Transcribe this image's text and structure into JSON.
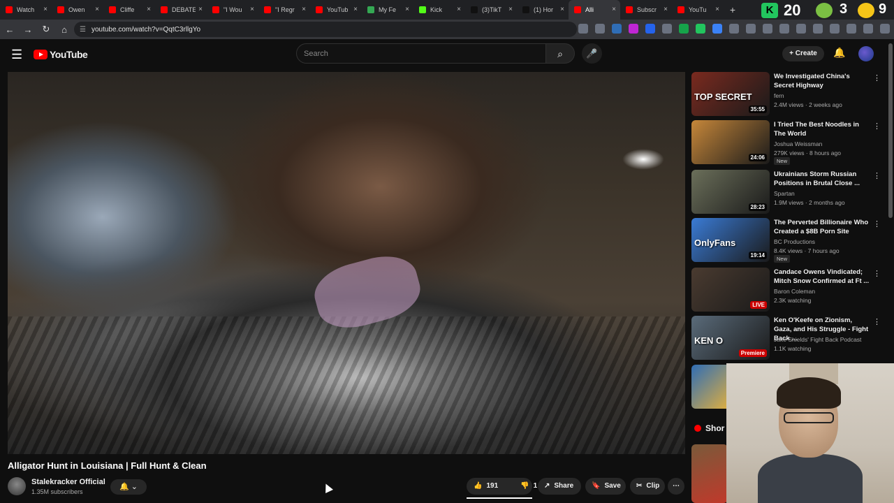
{
  "browser": {
    "tabs": [
      {
        "label": "Watch",
        "color": "#ff0000"
      },
      {
        "label": "Owen",
        "color": "#ff0000"
      },
      {
        "label": "Cliffe",
        "color": "#ff0000"
      },
      {
        "label": "DEBATE",
        "color": "#ff0000"
      },
      {
        "label": "\"I Wou",
        "color": "#ff0000"
      },
      {
        "label": "\"I Regr",
        "color": "#ff0000"
      },
      {
        "label": "YouTub",
        "color": "#ff0000"
      },
      {
        "label": "My Fe",
        "color": "#34a853"
      },
      {
        "label": "Kick",
        "color": "#53fc18"
      },
      {
        "label": "(3)TikT",
        "color": "#111111"
      },
      {
        "label": "(1) Hor",
        "color": "#111111"
      },
      {
        "label": "Alli",
        "color": "#ff0000",
        "active": true
      },
      {
        "label": "Subscr",
        "color": "#ff0000"
      },
      {
        "label": "YouTu",
        "color": "#ff0000"
      }
    ],
    "new_tab": "+",
    "ext_k": "K",
    "ext_count": "20",
    "ext_3": "3",
    "ext_9": "9",
    "url": "youtube.com/watch?v=QqtC3rllgYo"
  },
  "yt": {
    "logo": "YouTube",
    "search_placeholder": "Search",
    "create_label": "Create",
    "video": {
      "title": "Alligator Hunt in Louisiana | Full Hunt & Clean",
      "channel": "Stalekracker Official",
      "subscribers": "1.35M subscribers",
      "likes": "191",
      "dislikes": "1",
      "share_label": "Share",
      "save_label": "Save",
      "clip_label": "Clip"
    },
    "recommendations": [
      {
        "title": "We Investigated China's Secret Highway",
        "channel": "fern",
        "stats": "2.4M views · 2 weeks ago",
        "duration": "35:55",
        "overlay": "TOP SECRET",
        "thumb": "#7a2a1f"
      },
      {
        "title": "I Tried The Best Noodles in The World",
        "channel": "Joshua Weissman",
        "stats": "279K views · 8 hours ago",
        "badge": "New",
        "duration": "24:06",
        "overlay": "",
        "thumb": "#c6873a"
      },
      {
        "title": "Ukrainians Storm Russian Positions in Brutal Close ...",
        "channel": "Spartan",
        "stats": "1.9M views · 2 months ago",
        "duration": "28:23",
        "overlay": "",
        "thumb": "#6b6f5a"
      },
      {
        "title": "The Perverted Billionaire Who Created a $8B Porn Site",
        "channel": "BC Productions",
        "stats": "8.4K views · 7 hours ago",
        "badge": "New",
        "duration": "19:14",
        "overlay": "OnlyFans",
        "thumb": "#3a7bd5"
      },
      {
        "title": "Candace Owens Vindicated; Mitch Snow Confirmed at Ft ...",
        "channel": "Baron Coleman",
        "stats": "2.3K watching",
        "duration": "LIVE",
        "overlay": "",
        "thumb": "#4a3b30"
      },
      {
        "title": "Ken O'Keefe on Zionism, Gaza, and His Struggle - Fight Back ...",
        "channel": "Jake Shields' Fight Back Podcast",
        "stats": "1.1K watching",
        "duration": "Premiere",
        "overlay": "KEN O",
        "thumb": "#5a6b7a"
      }
    ],
    "shorts_label": "Shor"
  }
}
